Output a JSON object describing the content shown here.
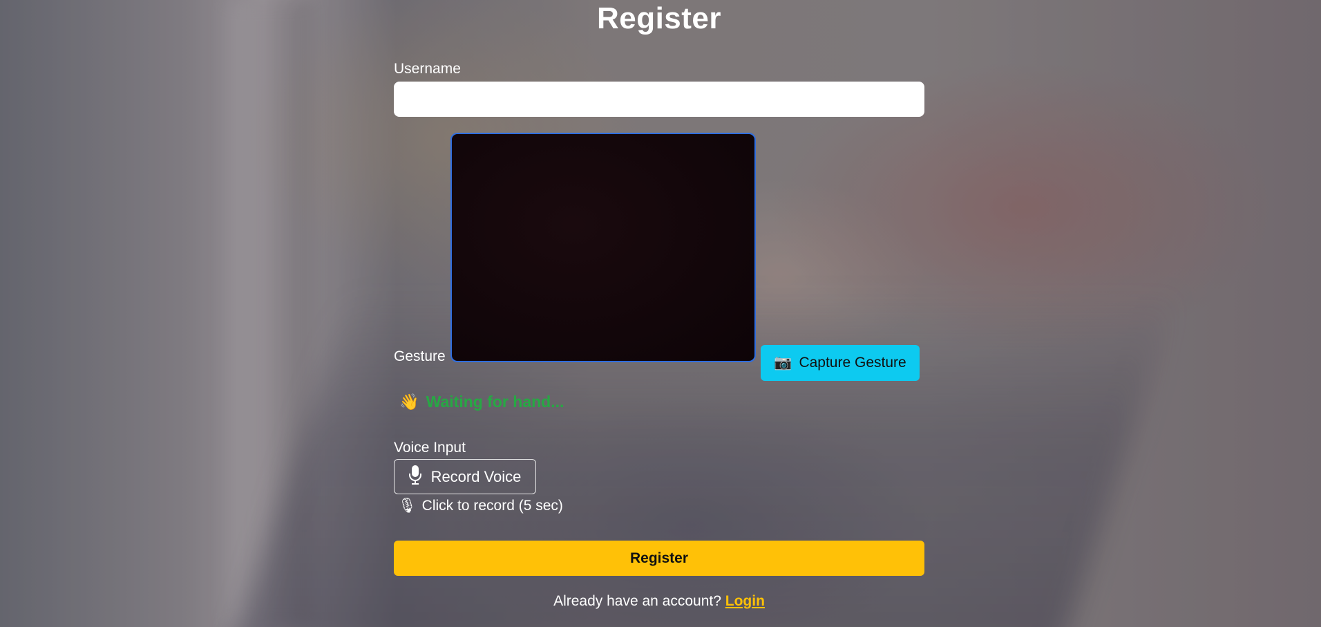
{
  "page": {
    "title": "Register"
  },
  "form": {
    "username_label": "Username",
    "username_value": "",
    "gesture_label": "Gesture",
    "capture_button": "Capture Gesture",
    "capture_icon": "📷",
    "gesture_status_icon": "👋",
    "gesture_status": "Waiting for hand...",
    "voice_label": "Voice Input",
    "record_button": "Record Voice",
    "record_icon": "microphone-icon",
    "record_hint_icon": "🎙",
    "record_hint": "Click to record (5 sec)",
    "register_button": "Register",
    "footer_text": "Already have an account?",
    "login_link": "Login"
  },
  "colors": {
    "capture_button": "#0dcaf0",
    "register_button": "#ffc107",
    "status_text": "#27a844",
    "login_link": "#ffc107",
    "video_border": "#2f6ee0"
  }
}
